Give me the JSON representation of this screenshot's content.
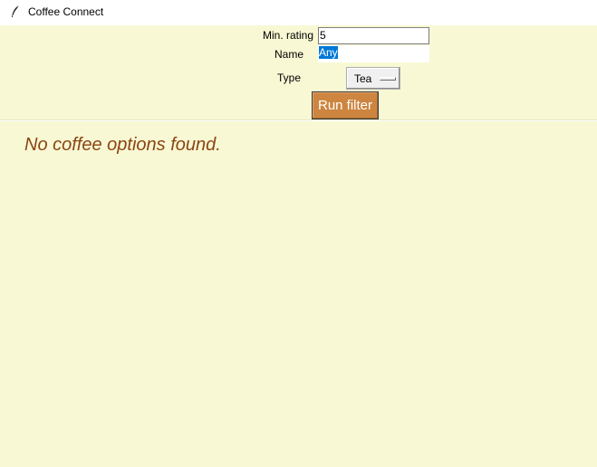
{
  "window": {
    "title": "Coffee Connect",
    "icon": "feather-icon"
  },
  "filters": {
    "rating_label": "Min. rating",
    "rating_value": "5",
    "name_label": "Name",
    "name_value": "Any",
    "type_label": "Type",
    "type_value": "Tea",
    "run_button_label": "Run filter"
  },
  "results": {
    "empty_message": "No coffee options found."
  },
  "colors": {
    "background": "#f8f8d4",
    "button": "#cd853f",
    "message": "#8b4513",
    "selection": "#0078d7"
  }
}
